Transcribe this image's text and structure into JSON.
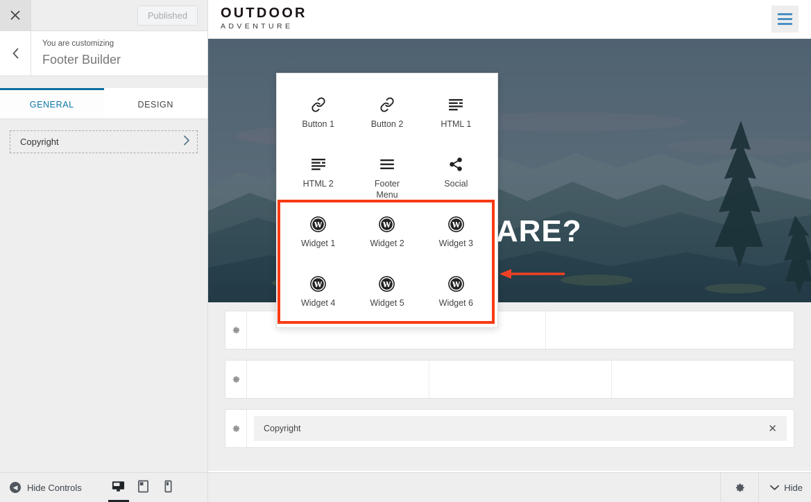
{
  "customizer": {
    "close_icon": "close-icon",
    "publish_label": "Published",
    "back_icon": "chevron-left-icon",
    "subtitle": "You are customizing",
    "title": "Footer Builder",
    "tabs": [
      {
        "label": "GENERAL",
        "active": true
      },
      {
        "label": "DESIGN",
        "active": false
      }
    ],
    "panel_items": [
      {
        "label": "Copyright",
        "chevron": "chevron-right-icon"
      }
    ]
  },
  "bottom_bar": {
    "hide_controls_label": "Hide Controls",
    "hide_controls_icon": "collapse-left-icon",
    "devices": [
      {
        "name": "desktop-icon",
        "active": true
      },
      {
        "name": "tablet-icon",
        "active": false
      },
      {
        "name": "mobile-icon",
        "active": false
      }
    ],
    "gear_icon": "gear-icon",
    "hide_footer_label": "Hide",
    "hide_footer_icon": "chevron-down-icon"
  },
  "preview": {
    "site_logo": {
      "main": "OUTDOOR",
      "sub": "ADVENTURE"
    },
    "menu_icon": "hamburger-menu-icon",
    "hero_title": "WE ARE?",
    "footer_builder": {
      "gear_icon": "gear-icon",
      "rows": [
        {
          "name": "footer-row-1",
          "columns": 2
        },
        {
          "name": "footer-row-2",
          "columns": 3
        },
        {
          "name": "footer-row-3",
          "columns": 1,
          "chip": {
            "label": "Copyright",
            "remove_icon": "close-icon"
          }
        }
      ]
    }
  },
  "widget_picker": {
    "items": [
      {
        "label": "Button 1",
        "icon": "link-icon",
        "highlighted": false
      },
      {
        "label": "Button 2",
        "icon": "link-icon",
        "highlighted": false
      },
      {
        "label": "HTML 1",
        "icon": "text-lines-icon",
        "highlighted": false
      },
      {
        "label": "HTML 2",
        "icon": "text-lines-icon",
        "highlighted": false
      },
      {
        "label": "Footer\nMenu",
        "icon": "menu-lines-icon",
        "highlighted": false
      },
      {
        "label": "Social",
        "icon": "share-icon",
        "highlighted": false
      },
      {
        "label": "Widget 1",
        "icon": "wordpress-icon",
        "highlighted": true
      },
      {
        "label": "Widget 2",
        "icon": "wordpress-icon",
        "highlighted": true
      },
      {
        "label": "Widget 3",
        "icon": "wordpress-icon",
        "highlighted": true
      },
      {
        "label": "Widget 4",
        "icon": "wordpress-icon",
        "highlighted": true
      },
      {
        "label": "Widget 5",
        "icon": "wordpress-icon",
        "highlighted": true
      },
      {
        "label": "Widget 6",
        "icon": "wordpress-icon",
        "highlighted": true
      }
    ]
  },
  "annotations": {
    "highlight_color": "#f93a13",
    "arrow_color": "#f04124"
  }
}
